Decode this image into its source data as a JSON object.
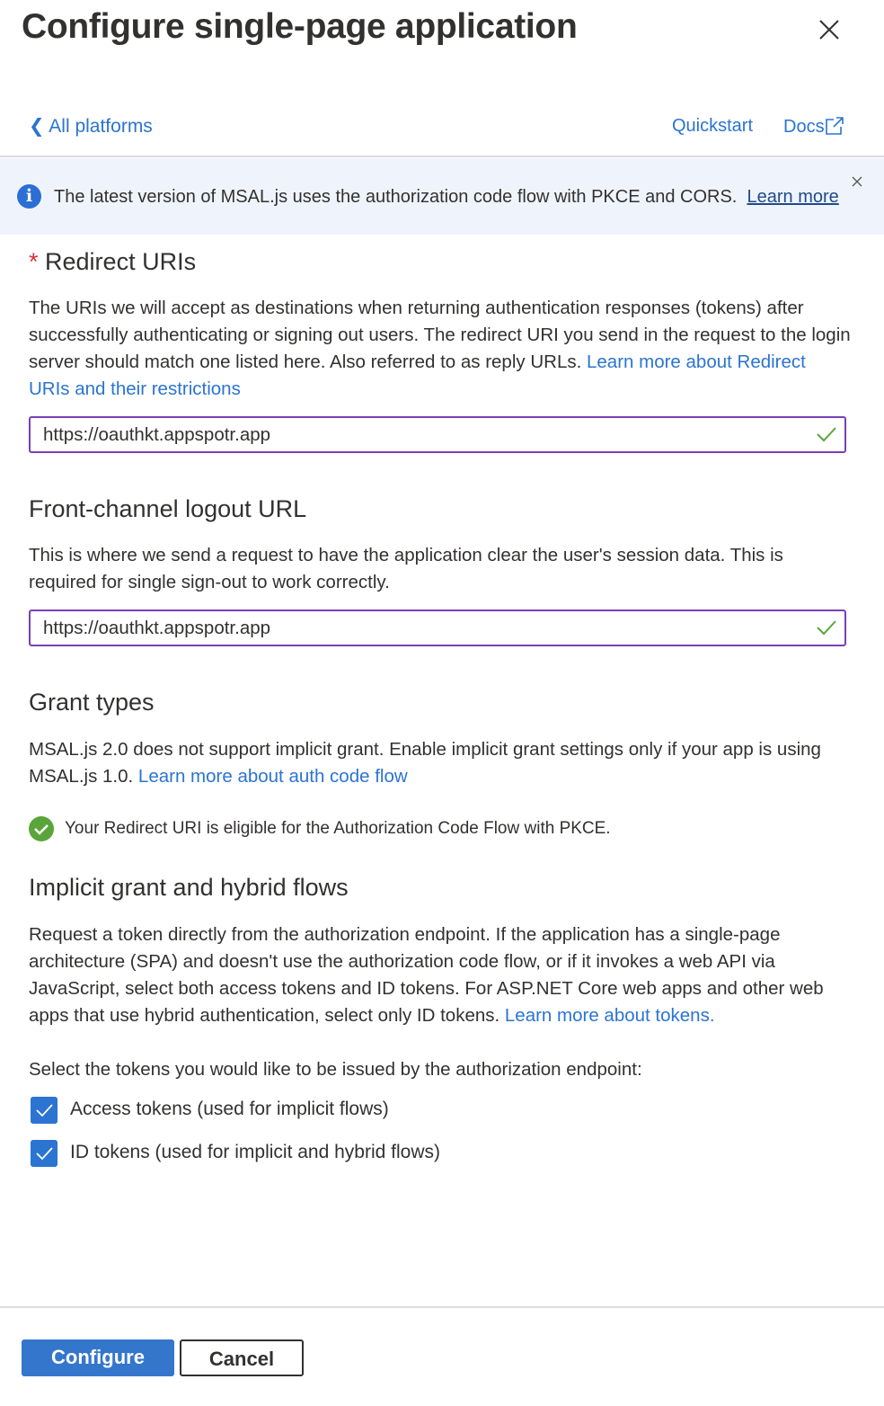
{
  "header": {
    "title": "Configure single-page application",
    "close_icon": "close-icon"
  },
  "nav": {
    "back_label": "All platforms",
    "quickstart": "Quickstart",
    "docs": "Docs"
  },
  "banner": {
    "text": "The latest version of MSAL.js uses the authorization code flow with PKCE and CORS.",
    "link": "Learn more"
  },
  "redirect": {
    "required_mark": "*",
    "heading": "Redirect URIs",
    "description": "The URIs we will accept as destinations when returning authentication responses (tokens) after successfully authenticating or signing out users. The redirect URI you send in the request to the login server should match one listed here. Also referred to as reply URLs.",
    "link": "Learn more about Redirect URIs and their restrictions",
    "value": "https://oauthkt.appspotr.app"
  },
  "logout": {
    "heading": "Front-channel logout URL",
    "description": "This is where we send a request to have the application clear the user's session data. This is required for single sign-out to work correctly.",
    "value": "https://oauthkt.appspotr.app"
  },
  "grant": {
    "heading": "Grant types",
    "description": "MSAL.js 2.0 does not support implicit grant. Enable implicit grant settings only if your app is using MSAL.js 1.0.",
    "link": "Learn more about auth code flow",
    "status": "Your Redirect URI is eligible for the Authorization Code Flow with PKCE."
  },
  "implicit": {
    "heading": "Implicit grant and hybrid flows",
    "description": "Request a token directly from the authorization endpoint. If the application has a single-page architecture (SPA) and doesn't use the authorization code flow, or if it invokes a web API via JavaScript, select both access tokens and ID tokens. For ASP.NET Core web apps and other web apps that use hybrid authentication, select only ID tokens.",
    "link": "Learn more about tokens.",
    "select_prompt": "Select the tokens you would like to be issued by the authorization endpoint:",
    "options": [
      {
        "label": "Access tokens (used for implicit flows)",
        "checked": true
      },
      {
        "label": "ID tokens (used for implicit and hybrid flows)",
        "checked": true
      }
    ]
  },
  "footer": {
    "configure": "Configure",
    "cancel": "Cancel"
  },
  "colors": {
    "accent": "#2b74d1",
    "primary_button": "#3476cc",
    "input_border": "#7b3fb5",
    "success": "#5aa53a",
    "banner_bg": "#eff4fc"
  }
}
